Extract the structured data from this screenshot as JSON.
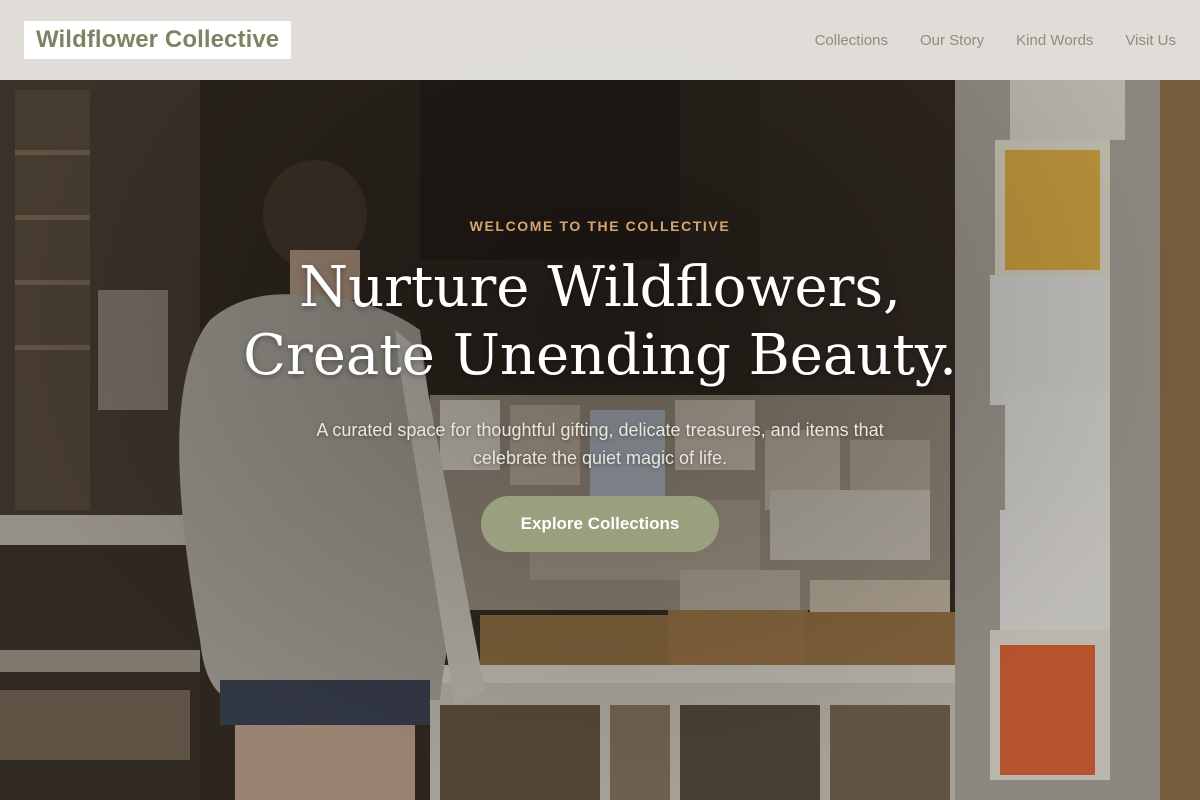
{
  "site": {
    "logo": "Wildflower Collective"
  },
  "nav": {
    "items": [
      {
        "label": "Collections"
      },
      {
        "label": "Our Story"
      },
      {
        "label": "Kind Words"
      },
      {
        "label": "Visit Us"
      }
    ]
  },
  "hero": {
    "eyebrow": "WELCOME TO THE COLLECTIVE",
    "title_line1": "Nurture Wildflowers,",
    "title_line2": "Create Unending Beauty.",
    "subtitle": "A curated space for thoughtful gifting, delicate treasures, and items that celebrate the quiet magic of life.",
    "cta_label": "Explore Collections"
  },
  "colors": {
    "accent": "#9aa07e",
    "logo_text": "#7d8463",
    "eyebrow": "#d6a56e",
    "header_bg": "#eeece6"
  }
}
